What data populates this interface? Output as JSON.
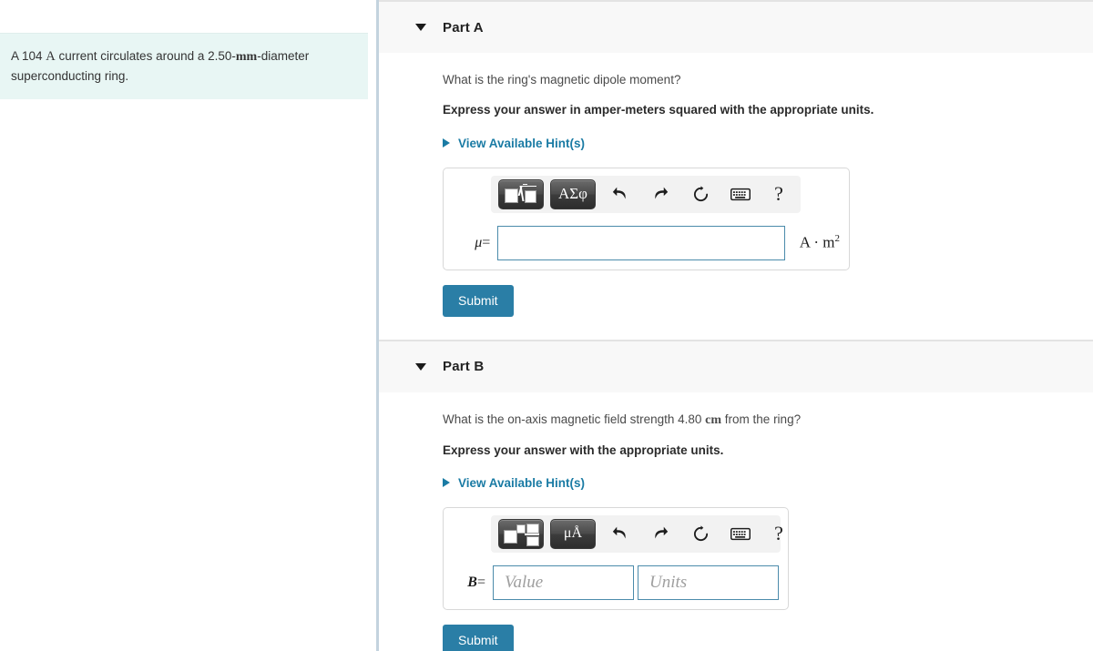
{
  "problem": {
    "text_parts": [
      "A 104 ",
      "A",
      " current circulates around a 2.50-",
      "mm",
      "-diameter superconducting ring."
    ],
    "full_text": "A 104 A current circulates around a 2.50-mm-diameter superconducting ring.",
    "background_color": "#e8f6f4"
  },
  "parts": [
    {
      "title": "Part A",
      "question": "What is the ring's magnetic dipole moment?",
      "instruction": "Express your answer in amper-meters squared with the appropriate units.",
      "hint_label": "View Available Hint(s)",
      "toolbar": {
        "template_button": "sqrt-template-icon",
        "greek_button": "ΑΣφ",
        "undo": "undo-icon",
        "redo": "redo-icon",
        "reset": "reset-icon",
        "keyboard": "keyboard-icon",
        "help": "?"
      },
      "answer": {
        "variable": "μ",
        "equals": "=",
        "value": "",
        "placeholder": "",
        "units_text": "A · m",
        "units_sup": "2"
      },
      "submit_label": "Submit"
    },
    {
      "title": "Part B",
      "question_parts": [
        "What is the on-axis magnetic field strength 4.80 ",
        "cm",
        " from the ring?"
      ],
      "question": "What is the on-axis magnetic field strength 4.80 cm from the ring?",
      "instruction": "Express your answer with the appropriate units.",
      "hint_label": "View Available Hint(s)",
      "toolbar": {
        "template_button": "fraction-template-icon",
        "greek_button": "μÅ",
        "undo": "undo-icon",
        "redo": "redo-icon",
        "reset": "reset-icon",
        "keyboard": "keyboard-icon",
        "help": "?"
      },
      "answer": {
        "variable": "B",
        "equals": "=",
        "value": "",
        "value_placeholder": "Value",
        "units_value": "",
        "units_placeholder": "Units"
      },
      "submit_label": "Submit"
    }
  ],
  "colors": {
    "accent": "#1a7ba4",
    "submit": "#2a7ea6",
    "statement_bg": "#e8f6f4",
    "header_bg": "#f8f8f8",
    "input_border": "#4b8bab",
    "divider": "#c3d3de"
  }
}
